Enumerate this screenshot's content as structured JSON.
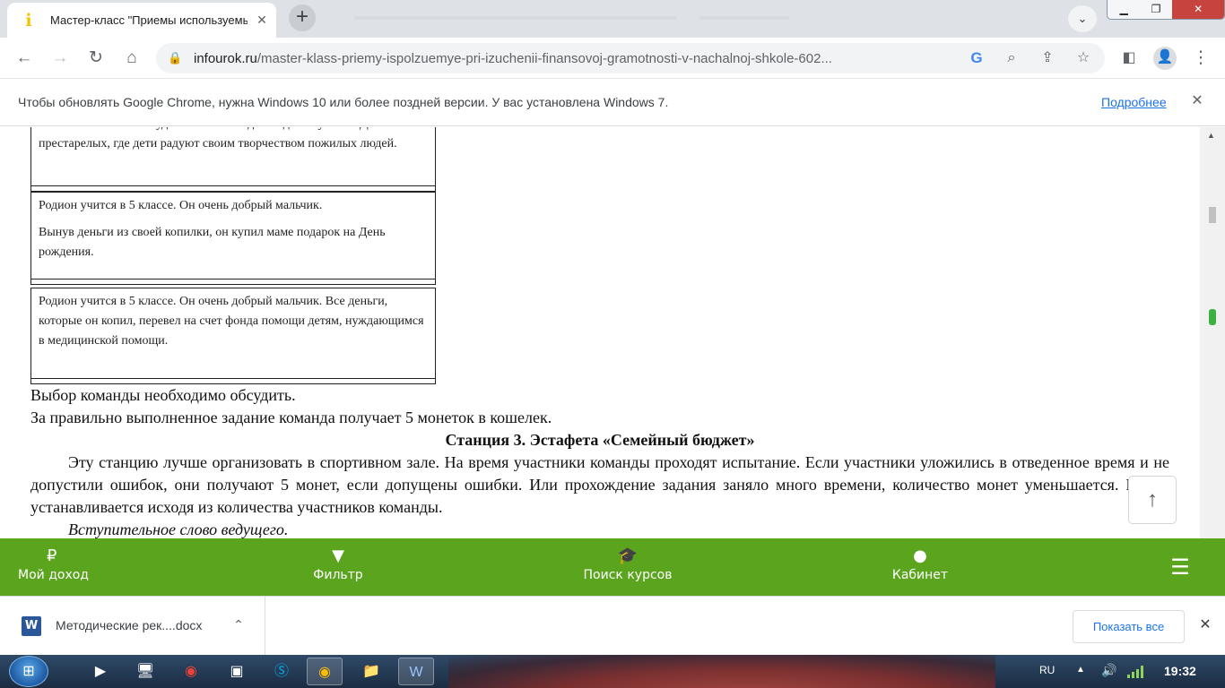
{
  "browser": {
    "tab": {
      "title": "Мастер-класс \"Приемы используемые при изучении финансовой грамотности\""
    },
    "url": {
      "host": "infourok.ru",
      "path": "/master-klass-priemy-ispolzuemye-pri-izuchenii-finansovoj-gramotnosti-v-nachalnoj-shkole-602..."
    },
    "infobar": {
      "message": "Чтобы обновлять Google Chrome, нужна Windows 10 или более поздней версии. У вас установлена Windows 7.",
      "link": "Подробнее"
    }
  },
  "content": {
    "cards": [
      {
        "paragraphs": [
          "вместе с вокальной студией Алина каждый год выступает в Доме престарелых, где дети радуют своим творчеством пожилых людей."
        ]
      },
      {
        "paragraphs": [
          "Родион учится в 5 классе. Он очень добрый мальчик.",
          "Вынув деньги из своей копилки, он купил маме подарок  на День рождения."
        ]
      },
      {
        "paragraphs": [
          "Родион учится в 5 классе. Он очень добрый мальчик.  Все деньги, которые он копил, перевел на счет фонда помощи детям, нуждающимся в медицинской помощи."
        ]
      }
    ],
    "line_choice": "Выбор команды необходимо обсудить.",
    "line_coins": "За правильно выполненное задание команда получает 5 монеток в кошелек.",
    "station_title": "Станция 3. Эстафета «Семейный бюджет»",
    "paragraph_1": "Эту станцию лучше организовать в спортивном зале. На время участники команды проходят испытание. Если участники уложились в отведенное время и не допустили ошибок, они получают 5 монет, если допущены ошибки. Или прохождение задания заняло много времени, количество монет уменьшается. Время устанавливается исходя из количества участников команды.",
    "paragraph_2": "Вступительное слово ведущего."
  },
  "site_nav": {
    "items": [
      {
        "label": "Мой доход",
        "icon": "ruble-icon"
      },
      {
        "label": "Фильтр",
        "icon": "filter-icon"
      },
      {
        "label": "Поиск курсов",
        "icon": "graduation-cap-icon"
      },
      {
        "label": "Кабинет",
        "icon": "user-icon"
      }
    ],
    "menu_icon": "hamburger-icon",
    "color": "#5aa41e"
  },
  "downloads": {
    "filename": "Методические рек....docx",
    "show_all": "Показать все"
  },
  "taskbar": {
    "language": "RU",
    "time": "19:32"
  }
}
